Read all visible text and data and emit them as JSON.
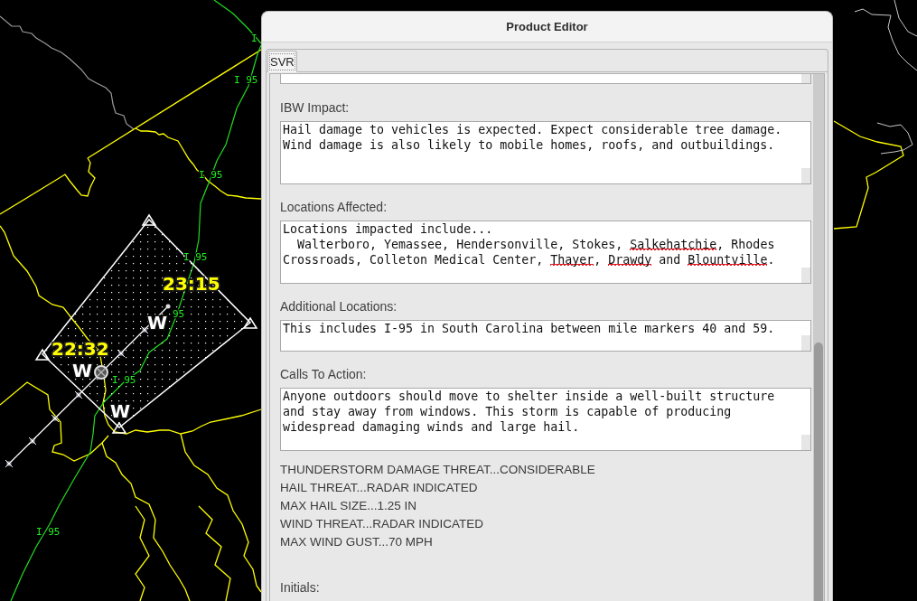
{
  "map": {
    "highway_labels": [
      "I",
      "I 95",
      "I 95",
      "I 95",
      "95",
      "I 95",
      "I 95"
    ],
    "time_labels": [
      "23:15",
      "22:32"
    ],
    "track_labels": [
      "W",
      "W",
      "W"
    ]
  },
  "window": {
    "title": "Product Editor"
  },
  "tabs": [
    {
      "label": "SVR",
      "selected": true
    }
  ],
  "sections": [
    {
      "label": "IBW Impact:",
      "text": [
        {
          "text": "Hail damage to vehicles is expected. Expect considerable tree damage.\nWind damage is also likely to mobile homes, roofs, and outbuildings.",
          "misspelled": false
        }
      ]
    },
    {
      "label": "Locations Affected:",
      "text": [
        {
          "text": "Locations impacted include...\n  Walterboro, Yemassee, Hendersonville, Stokes, ",
          "misspelled": false
        },
        {
          "text": "Salkehatchie",
          "misspelled": true
        },
        {
          "text": ", Rhodes\nCrossroads, Colleton Medical Center, ",
          "misspelled": false
        },
        {
          "text": "Thayer",
          "misspelled": true
        },
        {
          "text": ", ",
          "misspelled": false
        },
        {
          "text": "Drawdy",
          "misspelled": true
        },
        {
          "text": " and ",
          "misspelled": false
        },
        {
          "text": "Blountville",
          "misspelled": true
        },
        {
          "text": ".",
          "misspelled": false
        }
      ]
    },
    {
      "label": "Additional Locations:",
      "text": [
        {
          "text": "This includes I-95 in South Carolina between mile markers 40 and 59.",
          "misspelled": false
        }
      ]
    },
    {
      "label": "Calls To Action:",
      "text": [
        {
          "text": "Anyone outdoors should move to shelter inside a well-built structure\nand stay away from windows. This storm is capable of producing\nwidespread damaging winds and large hail.",
          "misspelled": false
        }
      ]
    }
  ],
  "threat_summary": [
    "THUNDERSTORM DAMAGE THREAT...CONSIDERABLE",
    "HAIL THREAT...RADAR INDICATED",
    "MAX HAIL SIZE...1.25 IN",
    "WIND THREAT...RADAR INDICATED",
    "MAX WIND GUST...70 MPH"
  ],
  "initials": {
    "label": "Initials:"
  }
}
